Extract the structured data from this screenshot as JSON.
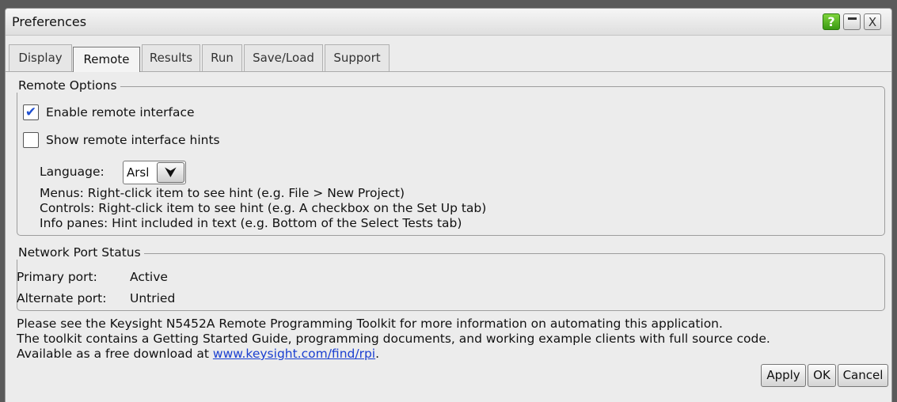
{
  "window": {
    "title": "Preferences"
  },
  "titlebar_buttons": {
    "help": "?",
    "close": "X"
  },
  "tabs": [
    {
      "label": "Display"
    },
    {
      "label": "Remote"
    },
    {
      "label": "Results"
    },
    {
      "label": "Run"
    },
    {
      "label": "Save/Load"
    },
    {
      "label": "Support"
    }
  ],
  "active_tab": "Remote",
  "remote_options": {
    "legend": "Remote Options",
    "enable_remote": {
      "label": "Enable remote interface",
      "checked": true
    },
    "show_hints": {
      "label": "Show remote interface hints",
      "checked": false
    },
    "language": {
      "label": "Language:",
      "value": "Arsl"
    },
    "hints": [
      "Menus: Right-click item to see hint (e.g. File > New Project)",
      "Controls: Right-click item to see hint (e.g. A checkbox on the Set Up tab)",
      "Info panes: Hint included in text (e.g. Bottom of the Select Tests tab)"
    ]
  },
  "network": {
    "legend": "Network Port Status",
    "primary": {
      "label": "Primary port:",
      "value": "Active"
    },
    "alternate": {
      "label": "Alternate port:",
      "value": "Untried"
    }
  },
  "info": {
    "line1": "Please see the Keysight N5452A Remote Programming Toolkit for more information on automating this application.",
    "line2": "The toolkit contains a Getting Started Guide, programming documents, and working example clients with full source code.",
    "line3_prefix": "Available as a free download at ",
    "link": "www.keysight.com/find/rpi",
    "line3_suffix": "."
  },
  "buttons": {
    "apply": "Apply",
    "ok": "OK",
    "cancel": "Cancel"
  },
  "colors": {
    "check_mark": "#1f4fd0",
    "link": "#1a3fd1",
    "help_button": "#4caf1e"
  }
}
